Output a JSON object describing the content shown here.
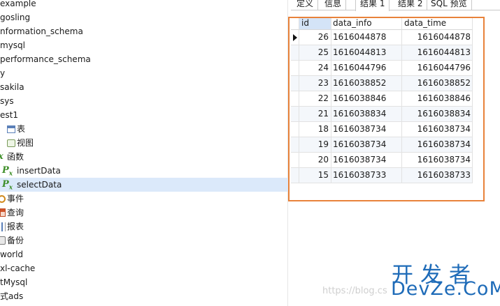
{
  "tree": {
    "items": [
      {
        "label": "example",
        "icon": "none",
        "selected": false
      },
      {
        "label": "gosling",
        "icon": "none",
        "selected": false
      },
      {
        "label": "nformation_schema",
        "icon": "none",
        "selected": false
      },
      {
        "label": "mysql",
        "icon": "none",
        "selected": false
      },
      {
        "label": "performance_schema",
        "icon": "none",
        "selected": false
      },
      {
        "label": "y",
        "icon": "none",
        "selected": false
      },
      {
        "label": "sakila",
        "icon": "none",
        "selected": false
      },
      {
        "label": "sys",
        "icon": "none",
        "selected": false
      },
      {
        "label": "est1",
        "icon": "none",
        "selected": false
      },
      {
        "label": "表",
        "icon": "table-icon",
        "selected": false
      },
      {
        "label": "视图",
        "icon": "view-icon",
        "selected": false
      },
      {
        "label": "函数",
        "icon": "function-icon",
        "selected": false
      },
      {
        "label": "insertData",
        "icon": "fx-icon",
        "selected": false
      },
      {
        "label": "selectData",
        "icon": "fx-icon",
        "selected": true
      },
      {
        "label": "事件",
        "icon": "event-icon",
        "selected": false
      },
      {
        "label": "查询",
        "icon": "query-icon",
        "selected": false
      },
      {
        "label": "报表",
        "icon": "report-icon",
        "selected": false
      },
      {
        "label": "备份",
        "icon": "backup-icon",
        "selected": false
      },
      {
        "label": "world",
        "icon": "none",
        "selected": false
      },
      {
        "label": "xl-cache",
        "icon": "none",
        "selected": false
      },
      {
        "label": "tMysql",
        "icon": "none",
        "selected": false
      },
      {
        "label": "式ads",
        "icon": "none",
        "selected": false
      }
    ]
  },
  "tabs": [
    {
      "label": "定义",
      "active": false
    },
    {
      "label": "信息",
      "active": false
    },
    {
      "label": "结果 1",
      "active": true
    },
    {
      "label": "结果 2",
      "active": false
    },
    {
      "label": "SQL 预览",
      "active": false
    }
  ],
  "grid": {
    "columns": [
      "id",
      "data_info",
      "data_time"
    ],
    "rows": [
      {
        "id": "26",
        "data_info": "1616044878",
        "data_time": "1616044878",
        "current": true
      },
      {
        "id": "25",
        "data_info": "1616044813",
        "data_time": "1616044813",
        "current": false
      },
      {
        "id": "24",
        "data_info": "1616044796",
        "data_time": "1616044796",
        "current": false
      },
      {
        "id": "23",
        "data_info": "1616038852",
        "data_time": "1616038852",
        "current": false
      },
      {
        "id": "22",
        "data_info": "1616038846",
        "data_time": "1616038846",
        "current": false
      },
      {
        "id": "21",
        "data_info": "1616038834",
        "data_time": "1616038834",
        "current": false
      },
      {
        "id": "18",
        "data_info": "1616038734",
        "data_time": "1616038734",
        "current": false
      },
      {
        "id": "19",
        "data_info": "1616038734",
        "data_time": "1616038734",
        "current": false
      },
      {
        "id": "20",
        "data_info": "1616038734",
        "data_time": "1616038734",
        "current": false
      },
      {
        "id": "15",
        "data_info": "1616038733",
        "data_time": "1616038733",
        "current": false
      }
    ]
  },
  "watermark": {
    "url": "https://blog.cs",
    "cn": "开发者",
    "en": "DevZe.CoM"
  },
  "colors": {
    "highlight_border": "#e8823a",
    "selection": "#dbe9fa",
    "watermark": "#1e6bb8"
  }
}
